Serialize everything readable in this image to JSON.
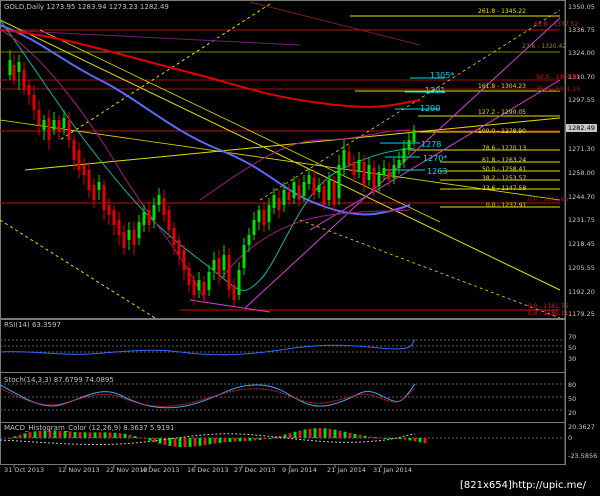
{
  "header": {
    "symbol": "GOLD,Daily",
    "ohlc": "1273.95 1283.94 1273.23 1282.49"
  },
  "colors": {
    "bull": "#00e000",
    "bear": "#e00000",
    "ma_blue": "#5a6cff",
    "ma_red": "#e00000",
    "channel": "#d048d0",
    "fib": "#e8e000",
    "trend": "#e0e000",
    "pivot": "#00d8f0"
  },
  "price_axis": {
    "labels": [
      "1350.05",
      "1336.75",
      "1324.00",
      "1310.70",
      "1297.55",
      "1284.25",
      "1271.30",
      "1258.00",
      "1244.70",
      "1231.75",
      "1218.45",
      "1205.55",
      "1192.20",
      "1179.25"
    ],
    "current_price": "1282.49"
  },
  "fib_levels": [
    {
      "text": "261.8 - 1345.22"
    },
    {
      "text": "161.8 - 1304.23"
    },
    {
      "text": "127.2 - 1290.05"
    },
    {
      "text": "100.0 - 1278.90"
    },
    {
      "text": "78.6 - 1270.13"
    },
    {
      "text": "61.8 - 1263.24"
    },
    {
      "text": "50.0 - 1258.41"
    },
    {
      "text": "38.2 - 1253.57"
    },
    {
      "text": "23.6 - 1247.58"
    },
    {
      "text": "0.0 - 1237.91"
    }
  ],
  "fib_levels_red": [
    {
      "text": "61.8 - 1337.52"
    },
    {
      "text": "23.6 - 1320.42"
    },
    {
      "text": "50.0 - 1307.80"
    },
    {
      "text": "38.2 - 1301.13"
    },
    {
      "text": "0.0 - 1241.66"
    },
    {
      "text": "0.0 - 1181.75"
    },
    {
      "text": "0.0 - 1180.11"
    }
  ],
  "pivot_labels": [
    "1305*",
    "1301",
    "1290",
    "1278",
    "1270*",
    "1263"
  ],
  "rsi": {
    "label": "RSI(14) 63.3597",
    "levels": [
      "70",
      "50",
      "30"
    ]
  },
  "stoch": {
    "label": "Stoch(14,3,3) 87.6799 74.0895",
    "levels": [
      "80",
      "50",
      "20"
    ]
  },
  "macd": {
    "label": "MACD_Histogram_Color (12,26,9) 8.3637 5.9191",
    "levels": [
      "20.3627",
      "0",
      "-23.5856"
    ]
  },
  "dates": [
    "31 Oct 2013",
    "12 Nov 2013",
    "22 Nov 2013",
    "4 Dec 2013",
    "16 Dec 2013",
    "27 Dec 2013",
    "9 Jan 2014",
    "21 Jan 2014",
    "31 Jan 2014"
  ],
  "watermark": "[821x654]http://upic.me/"
}
